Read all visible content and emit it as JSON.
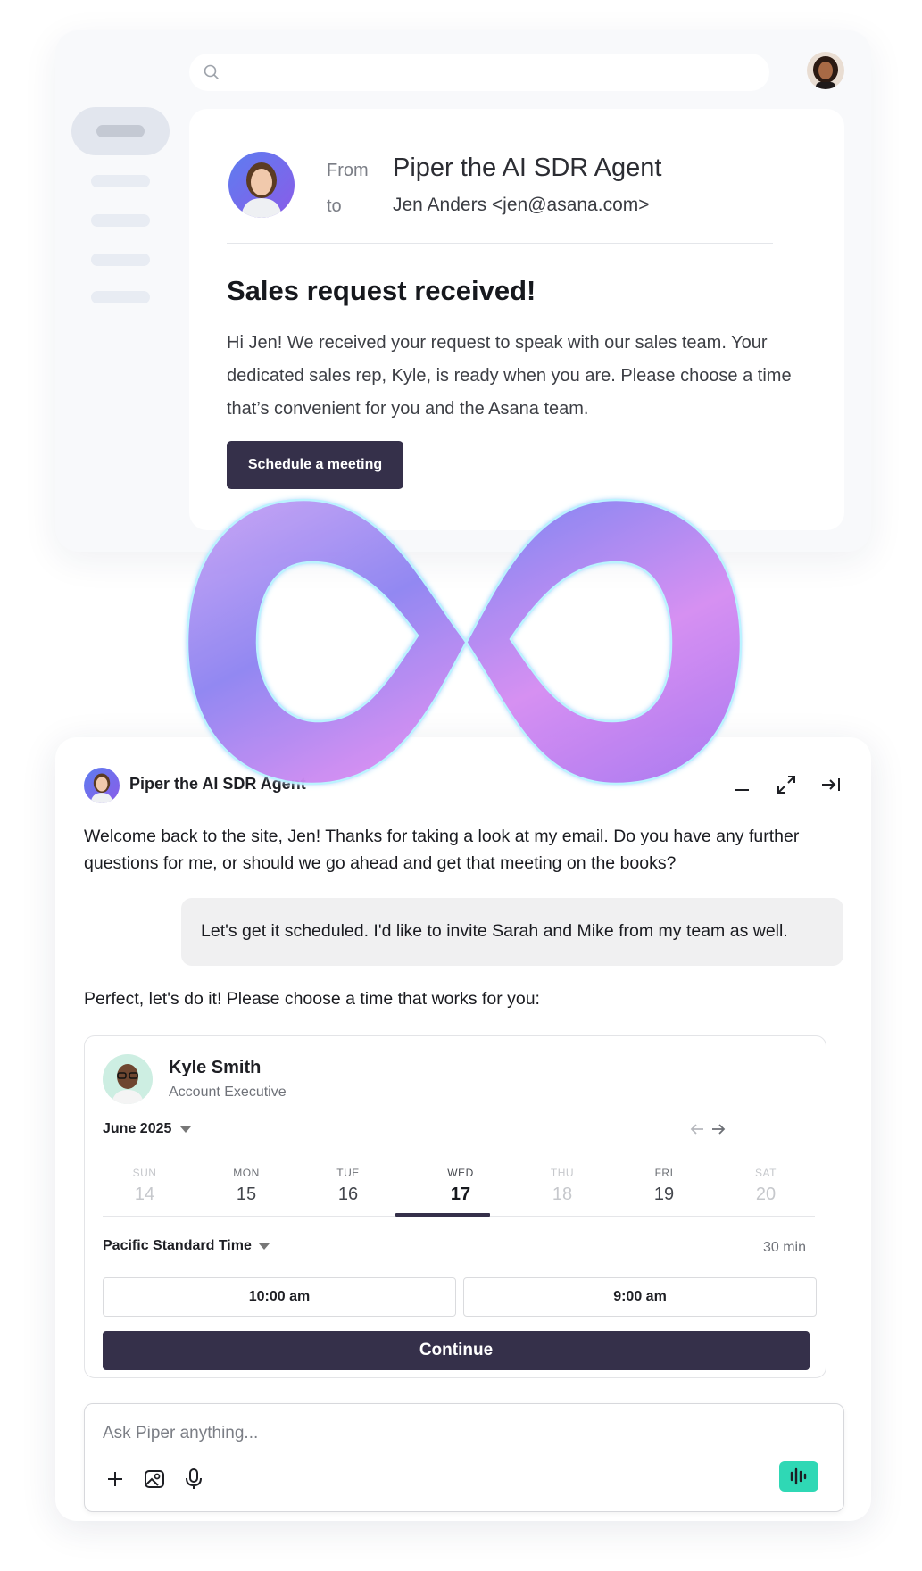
{
  "email": {
    "from_label": "From",
    "to_label": "to",
    "sender": "Piper the AI SDR Agent",
    "recipient": "Jen Anders <jen@asana.com>",
    "subject": "Sales request received!",
    "body": "Hi Jen! We received your request to speak with our sales team. Your dedicated sales rep, Kyle, is ready when you are. Please choose a time that’s convenient for you and the Asana team.",
    "cta_label": "Schedule a meeting"
  },
  "chat": {
    "agent_name": "Piper the AI SDR Agent",
    "agent_message": "Welcome back to the site, Jen! Thanks for taking a look at my email. Do you have any further questions for me, or should we go ahead and get that meeting on the books?",
    "user_message": "Let's get it scheduled. I'd like to invite Sarah and Mike from my team as well.",
    "agent_reply": "Perfect, let's do it! Please choose a time that works for you:",
    "controls": [
      "minimize-icon",
      "expand-icon",
      "collapse-to-side-icon"
    ]
  },
  "scheduler": {
    "rep_name": "Kyle Smith",
    "rep_title": "Account Executive",
    "month": "June 2025",
    "days": [
      {
        "dow": "SUN",
        "num": "14",
        "state": "disabled"
      },
      {
        "dow": "MON",
        "num": "15",
        "state": "available"
      },
      {
        "dow": "TUE",
        "num": "16",
        "state": "available"
      },
      {
        "dow": "WED",
        "num": "17",
        "state": "selected"
      },
      {
        "dow": "THU",
        "num": "18",
        "state": "disabled"
      },
      {
        "dow": "FRI",
        "num": "19",
        "state": "available"
      },
      {
        "dow": "SAT",
        "num": "20",
        "state": "disabled"
      }
    ],
    "timezone": "Pacific Standard Time",
    "duration": "30 min",
    "slots": [
      "10:00 am",
      "9:00 am"
    ],
    "continue_label": "Continue"
  },
  "composer": {
    "placeholder": "Ask Piper anything...",
    "value": "",
    "tools": [
      "plus-icon",
      "image-icon",
      "microphone-icon"
    ],
    "voice_icon": "waveform-icon"
  },
  "colors": {
    "primary_dark": "#35304a",
    "voice_accent": "#2fd8b5",
    "logo_gradient": [
      "#8c7cf0",
      "#c79af5",
      "#a36cf0"
    ]
  }
}
